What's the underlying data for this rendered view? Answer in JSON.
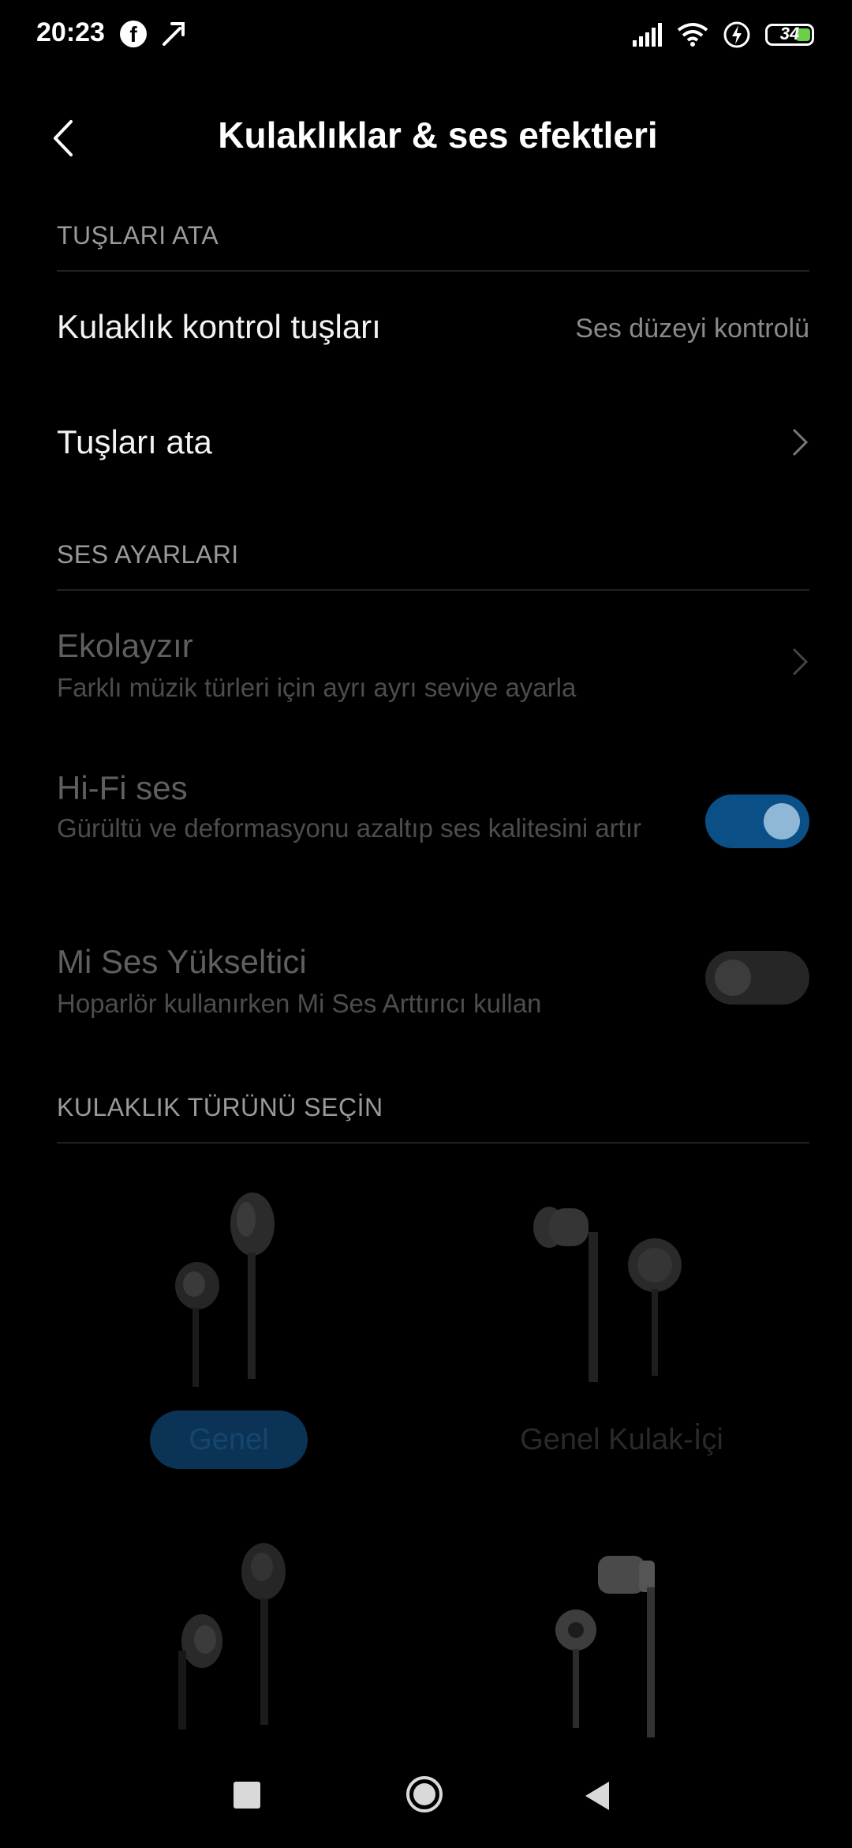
{
  "status_bar": {
    "time": "20:23",
    "battery": "34",
    "icons": [
      "facebook-icon",
      "tool-icon",
      "signal-icon",
      "wifi-icon",
      "charging-icon",
      "battery-icon"
    ]
  },
  "header": {
    "title": "Kulaklıklar & ses efektleri"
  },
  "section_buttons": {
    "header": "TUŞLARI ATA",
    "control_keys_label": "Kulaklık kontrol tuşları",
    "control_keys_value": "Ses düzeyi kontrolü",
    "assign_keys_label": "Tuşları ata"
  },
  "section_audio": {
    "header": "SES AYARLARI",
    "equalizer_title": "Ekolayzır",
    "equalizer_subtitle": "Farklı müzik türleri için ayrı ayrı seviye ayarla",
    "hifi_title": "Hi-Fi ses",
    "hifi_subtitle": "Gürültü ve deformasyonu azaltıp ses kalitesini artır",
    "hifi_enabled": true,
    "booster_title": "Mi Ses Yükseltici",
    "booster_subtitle": "Hoparlör kullanırken Mi Ses Arttırıcı kullan",
    "booster_enabled": false
  },
  "section_headphone_type": {
    "header": "KULAKLIK TÜRÜNÜ SEÇİN",
    "types": [
      {
        "label": "Genel",
        "selected": true
      },
      {
        "label": "Genel Kulak-İçi",
        "selected": false
      }
    ]
  },
  "colors": {
    "accent": "#0a4f86",
    "background": "#000000"
  }
}
